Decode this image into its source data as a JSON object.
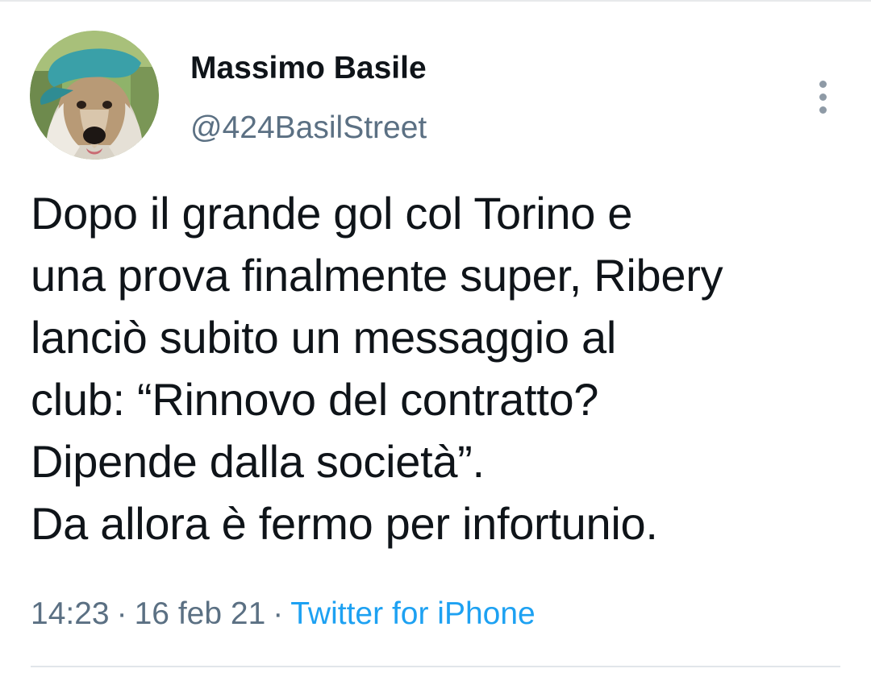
{
  "author": {
    "display_name": "Massimo Basile",
    "handle": "@424BasilStreet",
    "avatar_icon": "dog-avatar-icon"
  },
  "actions": {
    "more_icon": "more-vertical-icon"
  },
  "tweet": {
    "lines": [
      "Dopo il grande gol col Torino e",
      "una prova finalmente super, Ribery",
      "lanciò subito un messaggio al",
      "club: “Rinnovo del contratto?",
      "Dipende dalla società”.",
      "Da allora è fermo per infortunio."
    ]
  },
  "meta": {
    "time": "14:23",
    "separator": "·",
    "date": "16 feb 21",
    "source": "Twitter for iPhone"
  },
  "colors": {
    "text": "#0f1419",
    "secondary": "#5b7083",
    "link": "#1da1f2",
    "divider": "#e1e6ea"
  }
}
